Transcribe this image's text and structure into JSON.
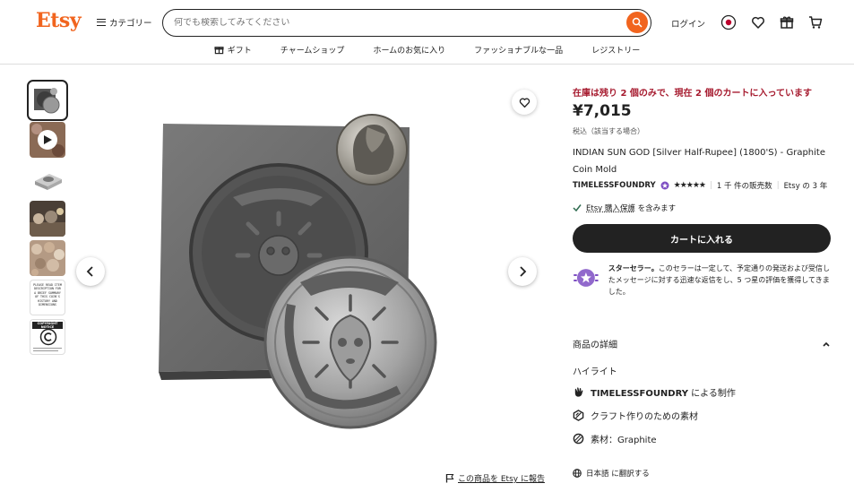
{
  "header": {
    "logo": "Etsy",
    "categories_label": "カテゴリー",
    "search_placeholder": "何でも検索してみてください",
    "login_label": "ログイン"
  },
  "subnav": [
    {
      "label": "ギフト",
      "icon": "gift-icon"
    },
    {
      "label": "チャームショップ"
    },
    {
      "label": "ホームのお気に入り"
    },
    {
      "label": "ファッショナブルな一品"
    },
    {
      "label": "レジストリー"
    }
  ],
  "product": {
    "stock_notice": "在庫は残り 2 個のみで、現在 2 個のカートに入っています",
    "price": "¥7,015",
    "tax_note": "税込（該当する場合）",
    "title": "INDIAN SUN GOD [Silver Half-Rupee] (1800'S) - Graphite Coin Mold",
    "shop_name": "TIMELESSFOUNDRY",
    "stars": "★★★★★",
    "rating": 5,
    "sales": "1 千 件の販売数",
    "tenure": "Etsy の 3 年",
    "protection_link": "Etsy 購入保護",
    "protection_suffix": " を含みます",
    "cart_button": "カートに入れる",
    "star_seller_title": "スターセラー。",
    "star_seller_text": "このセラーは一定して、予定通りの発送および受信したメッセージに対する迅速な返信をし、5 つ星の評価を獲得してきました。",
    "report_label": "この商品を Etsy に報告",
    "thumbnail_text": "PLEASE READ ITEM DESCRIPTION FOR A BRIEF SUMMARY OF THIS COIN'S HISTORY AND DIMENSIONS",
    "thumbnail_notice": "COPYRIGHT NOTICE"
  },
  "details": {
    "header": "商品の詳細",
    "highlights_title": "ハイライト",
    "maker_shop": "TIMELESSFOUNDRY",
    "maker_suffix": " による制作",
    "craft_supply": "クラフト作りのための素材",
    "material": "素材：Graphite",
    "translate": "日本語 に翻訳する"
  },
  "colors": {
    "brand": "#f1641e",
    "stock": "#a61a2e",
    "star_seller": "#7e4fc3"
  }
}
